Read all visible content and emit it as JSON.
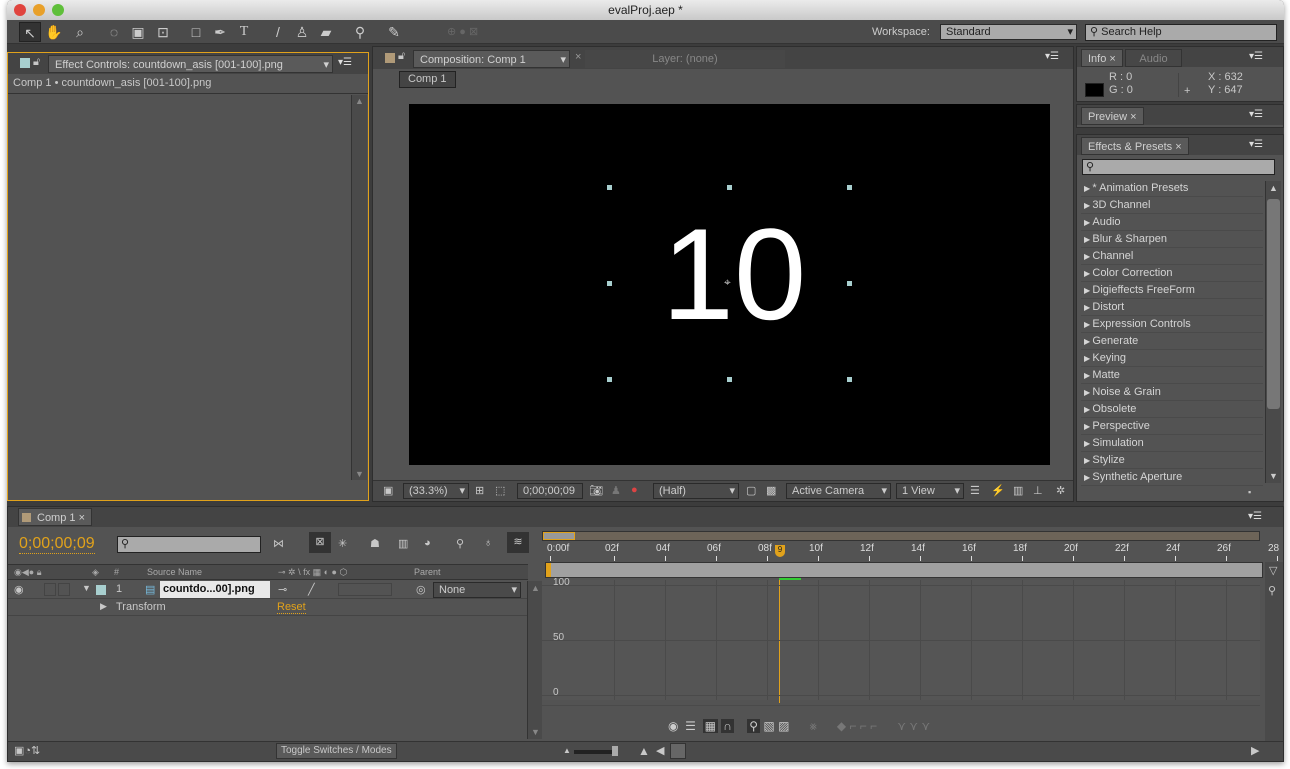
{
  "window": {
    "title": "evalProj.aep *"
  },
  "toolbar": {
    "tools": [
      "selection-tool",
      "hand-tool",
      "zoom-tool",
      "rotation-tool",
      "camera-tool",
      "pan-behind-tool",
      "rectangle-tool",
      "pen-tool",
      "type-tool",
      "brush-tool",
      "clone-stamp-tool",
      "eraser-tool",
      "roto-brush-tool",
      "puppet-pin-tool"
    ],
    "workspace_label": "Workspace:",
    "workspace_value": "Standard",
    "search_help_placeholder": "Search Help"
  },
  "effect_controls": {
    "tab": "Effect Controls: countdown_asis [001-100].png",
    "breadcrumb": "Comp 1 • countdown_asis [001-100].png"
  },
  "composition": {
    "tab": "Composition: Comp 1",
    "layer_tab": "Layer: (none)",
    "comp_button": "Comp 1",
    "frame_text": "10",
    "zoom": "(33.3%)",
    "timecode": "0;00;00;09",
    "resolution": "(Half)",
    "camera": "Active Camera",
    "views": "1 View"
  },
  "info": {
    "tab": "Info",
    "audio_tab": "Audio",
    "r": "R : 0",
    "g": "G : 0",
    "x": "X : 632",
    "y": "Y : 647",
    "swatch_color": "#000000"
  },
  "preview": {
    "tab": "Preview"
  },
  "effects_presets": {
    "tab": "Effects & Presets",
    "items": [
      "* Animation Presets",
      "3D Channel",
      "Audio",
      "Blur & Sharpen",
      "Channel",
      "Color Correction",
      "Digieffects FreeForm",
      "Distort",
      "Expression Controls",
      "Generate",
      "Keying",
      "Matte",
      "Noise & Grain",
      "Obsolete",
      "Perspective",
      "Simulation",
      "Stylize",
      "Synthetic Aperture"
    ]
  },
  "timeline": {
    "tab": "Comp 1",
    "current_time": "0;00;00;09",
    "columns": {
      "number": "#",
      "source_name": "Source Name",
      "parent": "Parent"
    },
    "layer": {
      "number": "1",
      "name": "countdo...00].png",
      "parent": "None"
    },
    "transform_label": "Transform",
    "reset_label": "Reset",
    "ruler": [
      "0:00f",
      "02f",
      "04f",
      "06f",
      "08f",
      "10f",
      "12f",
      "14f",
      "16f",
      "18f",
      "20f",
      "22f",
      "24f",
      "26f",
      "28"
    ],
    "current_frame_marker": "9",
    "graph_labels": [
      "100",
      "50",
      "0"
    ],
    "toggle_button": "Toggle Switches / Modes"
  },
  "colors": {
    "accent": "#e1a21b",
    "panel": "#535353",
    "label_swatch": "#a8cfcf"
  }
}
